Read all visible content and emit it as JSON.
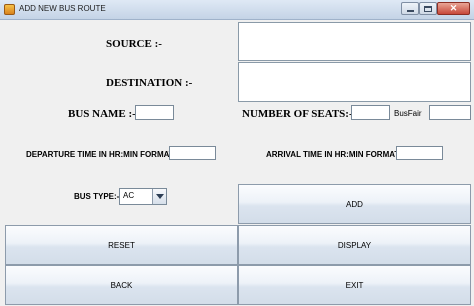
{
  "window": {
    "title": "ADD NEW BUS ROUTE",
    "close_glyph": "✕"
  },
  "form": {
    "source_label": "SOURCE :-",
    "source_value": "",
    "destination_label": "DESTINATION :-",
    "destination_value": "",
    "bus_name_label": "BUS NAME :-",
    "bus_name_value": "",
    "seats_label": "NUMBER OF SEATS:-",
    "seats_value": "",
    "busfair_label": "BusFair",
    "busfair_value": "",
    "departure_label": "DEPARTURE TIME IN HR:MIN FORMAT",
    "departure_value": "",
    "arrival_label": "ARRIVAL TIME IN HR:MIN FORMAT",
    "arrival_value": "",
    "bus_type_label": "BUS TYPE:-",
    "bus_type_selected": "AC"
  },
  "buttons": {
    "add": "ADD",
    "reset": "RESET",
    "display": "DISPLAY",
    "back": "BACK",
    "exit": "EXIT"
  },
  "icons": {
    "app": "java-cup-icon",
    "minimize": "minimize-icon",
    "maximize": "maximize-icon",
    "close": "close-icon",
    "dropdown": "chevron-down-icon"
  }
}
